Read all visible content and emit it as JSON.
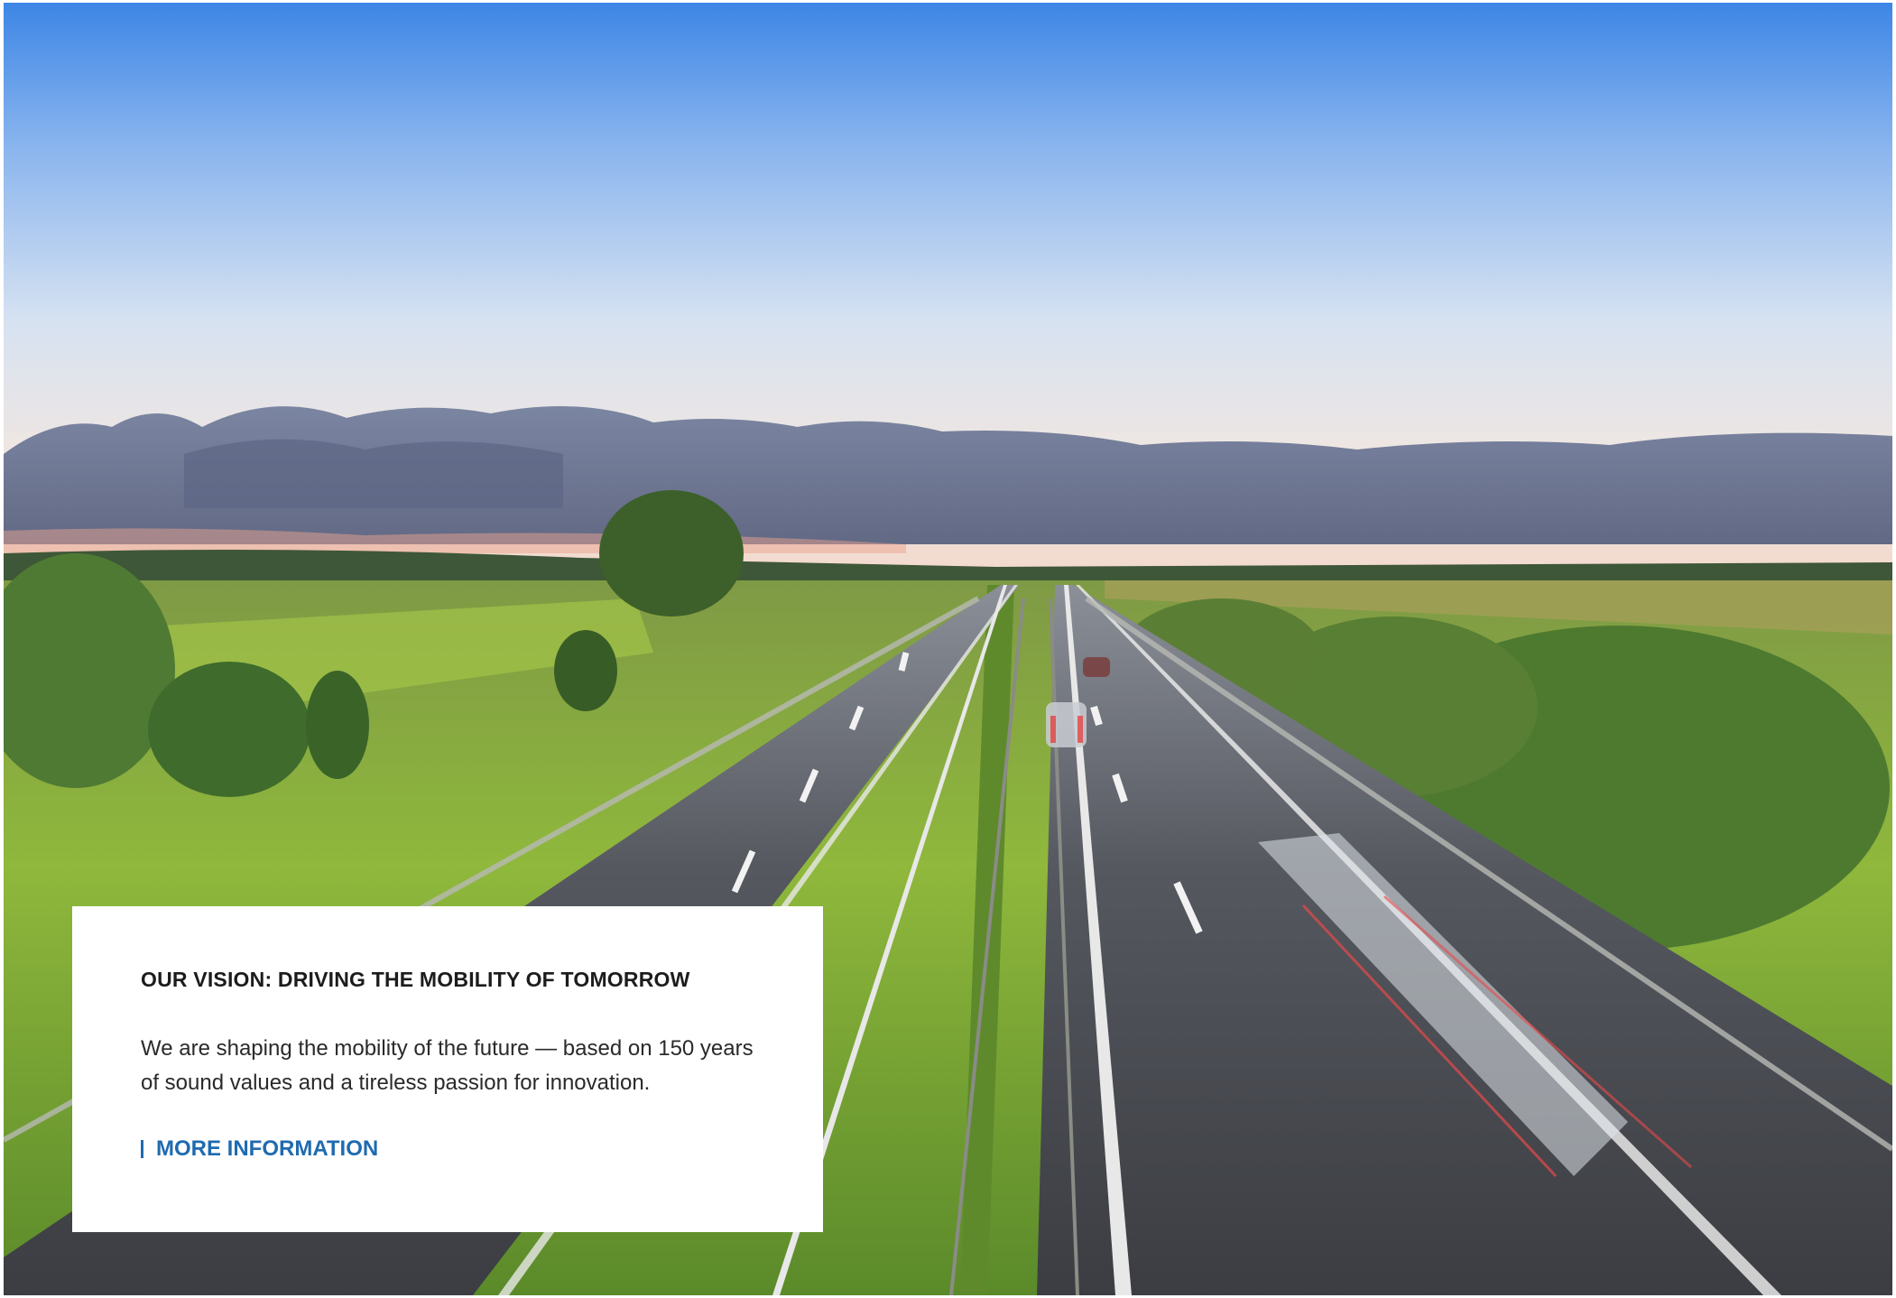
{
  "hero": {
    "image_description_icon": "highway-landscape-image"
  },
  "teaser": {
    "title": "OUR VISION: DRIVING THE MOBILITY OF TOMORROW",
    "body_line_1": "We are shaping the mobility of the future — based on 150 years",
    "body_line_2": "of sound values and a tireless passion for innovation.",
    "link_label": "MORE INFORMATION"
  },
  "colors": {
    "link": "#1f6bb0",
    "title": "#1c1c1c",
    "card_bg": "#ffffff"
  }
}
